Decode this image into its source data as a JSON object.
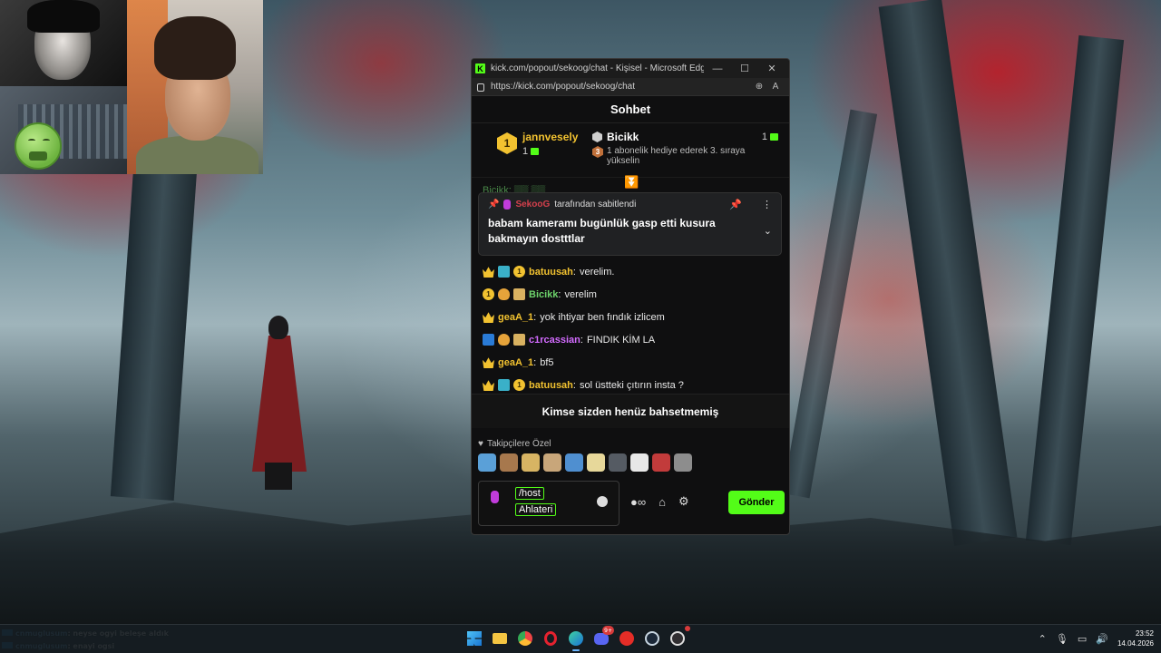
{
  "window": {
    "title": "kick.com/popout/sekoog/chat - Kişisel - Microsoft Edge",
    "url": "https://kick.com/popout/sekoog/chat",
    "logo_letter": "K"
  },
  "chat": {
    "header": "Sohbet",
    "gift_leader": {
      "rank": "1",
      "user": "jannvesely",
      "count": "1"
    },
    "gift_notice": {
      "user": "Bicikk",
      "count": "1",
      "rank": "3",
      "description": "1 abonelik hediye ederek 3. sıraya yükselin"
    },
    "ghost_line": "Bicikk: ▒▒ ▒▒",
    "pinned": {
      "pinned_by_user": "SekooG",
      "pinned_by_suffix": "tarafından sabitlendi",
      "message": "babam kameramı bugünlük gasp etti kusura bakmayın dostttlar"
    },
    "messages": [
      {
        "badges": [
          "crown",
          "sub",
          "one"
        ],
        "user": "batuusah",
        "user_color": "#f2c230",
        "text": "verelim."
      },
      {
        "badges": [
          "one",
          "medal",
          "gift"
        ],
        "user": "Bicikk",
        "user_color": "#6dd36b",
        "text": "verelim"
      },
      {
        "badges": [
          "crown"
        ],
        "user": "geaA_1",
        "user_color": "#f2c230",
        "text": "yok ihtiyar ben fındık izlicem"
      },
      {
        "badges": [
          "verify",
          "medal",
          "gift"
        ],
        "user": "c1rcassian",
        "user_color": "#d36bff",
        "text": "FINDIK KİM LA"
      },
      {
        "badges": [
          "crown"
        ],
        "user": "geaA_1",
        "user_color": "#f2c230",
        "text": "bf5"
      },
      {
        "badges": [
          "crown",
          "sub",
          "one"
        ],
        "user": "batuusah",
        "user_color": "#f2c230",
        "text": "sol üstteki çıtırın insta ?"
      }
    ],
    "mentions_text": "Kimse sizden henüz bahsetmemiş",
    "emote_section_label": "Takipçilere Özel",
    "emote_colors": [
      "#5aa0d8",
      "#a7784d",
      "#d7b463",
      "#c8a67a",
      "#4f8fd0",
      "#e7d89a",
      "#555b63",
      "#e8e8e8",
      "#c23b3b",
      "#8d8d8d"
    ],
    "composer": {
      "chip1": "/host",
      "chip2": "Ahlateri"
    },
    "send_label": "Gönder"
  },
  "stream_overlay": {
    "lines": [
      {
        "user": "cnmuglusum",
        "text": ": neyse ogyi beleşe aldık"
      },
      {
        "user": "cnmuglusum",
        "text": ": enayi ogsi"
      }
    ]
  },
  "taskbar": {
    "time": "23:52",
    "date": "14.04.2026",
    "discord_badge": "9+",
    "apps": [
      "start",
      "explorer",
      "chrome",
      "opera",
      "edge",
      "discord",
      "youtube-music",
      "steam",
      "obs"
    ]
  },
  "colors": {
    "kick_green": "#53fc18",
    "gold": "#f2c230",
    "pin_user": "#d4404c"
  }
}
